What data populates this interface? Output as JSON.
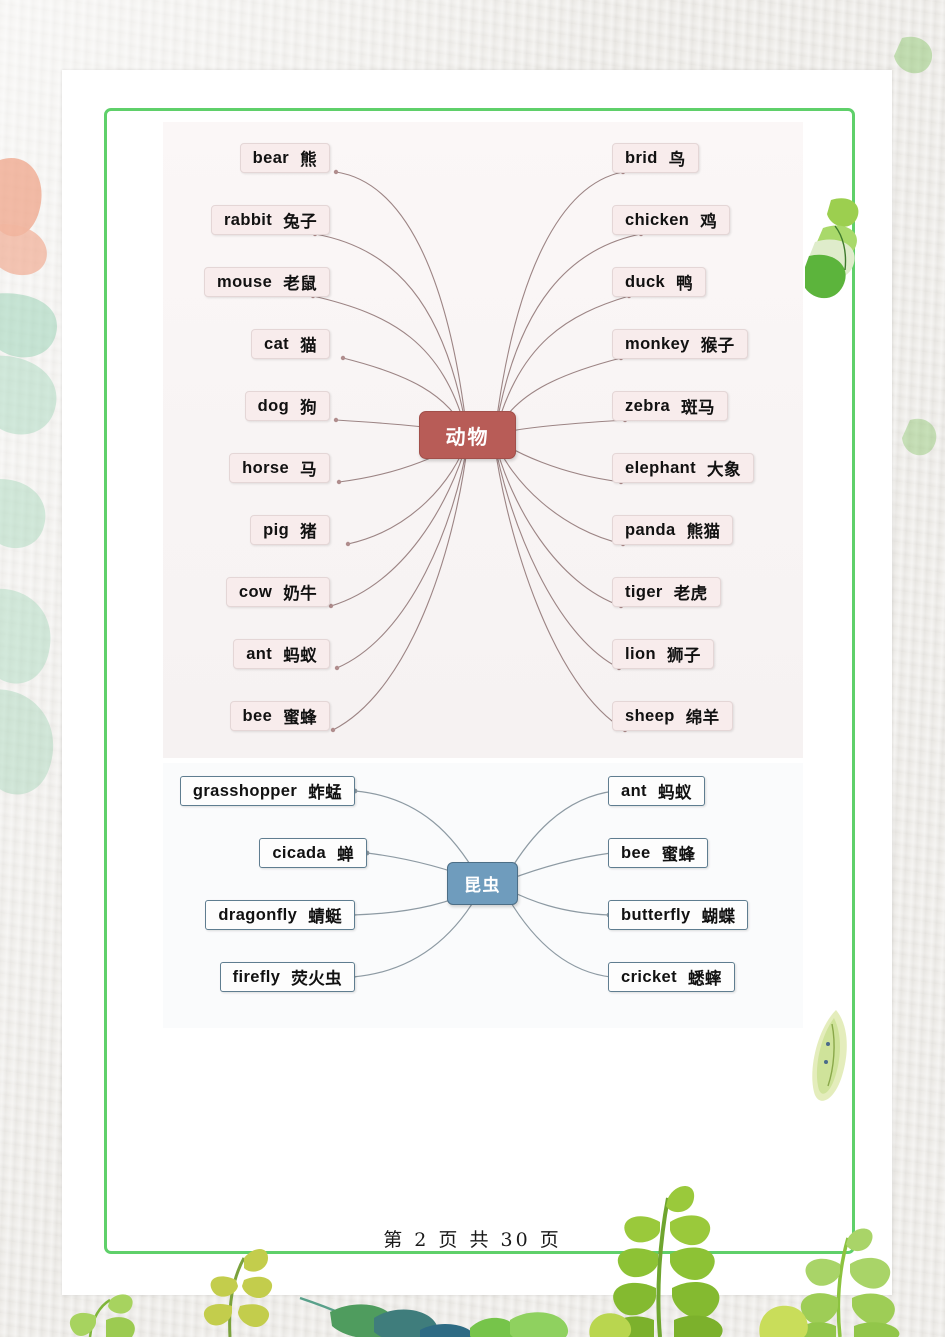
{
  "page": {
    "footer_text": "第 2 页 共 30 页",
    "page_number": "2",
    "total_pages": "30",
    "frame_color": "#5fd06a",
    "background_color": "#eceae6",
    "sheet_color": "#ffffff"
  },
  "animal_map": {
    "center": {
      "label": "动物",
      "color": "#b85c57",
      "text_color": "#ffffff"
    },
    "left_items": [
      {
        "en": "bear",
        "cn": "熊"
      },
      {
        "en": "rabbit",
        "cn": "兔子"
      },
      {
        "en": "mouse",
        "cn": "老鼠"
      },
      {
        "en": "cat",
        "cn": "猫"
      },
      {
        "en": "dog",
        "cn": "狗"
      },
      {
        "en": "horse",
        "cn": "马"
      },
      {
        "en": "pig",
        "cn": "猪"
      },
      {
        "en": "cow",
        "cn": "奶牛"
      },
      {
        "en": "ant",
        "cn": "蚂蚁"
      },
      {
        "en": "bee",
        "cn": "蜜蜂"
      }
    ],
    "right_items": [
      {
        "en": "brid",
        "cn": "鸟"
      },
      {
        "en": "chicken",
        "cn": "鸡"
      },
      {
        "en": "duck",
        "cn": "鸭"
      },
      {
        "en": "monkey",
        "cn": "猴子"
      },
      {
        "en": "zebra",
        "cn": "斑马"
      },
      {
        "en": "elephant",
        "cn": "大象"
      },
      {
        "en": "panda",
        "cn": "熊猫"
      },
      {
        "en": "tiger",
        "cn": "老虎"
      },
      {
        "en": "lion",
        "cn": "狮子"
      },
      {
        "en": "sheep",
        "cn": "绵羊"
      }
    ]
  },
  "insect_map": {
    "center": {
      "label": "昆虫",
      "color": "#6f9cbd",
      "text_color": "#ffffff"
    },
    "left_items": [
      {
        "en": "grasshopper",
        "cn": "蚱蜢"
      },
      {
        "en": "cicada",
        "cn": "蝉"
      },
      {
        "en": "dragonfly",
        "cn": "蜻蜓"
      },
      {
        "en": "firefly",
        "cn": "荧火虫"
      }
    ],
    "right_items": [
      {
        "en": "ant",
        "cn": "蚂蚁"
      },
      {
        "en": "bee",
        "cn": "蜜蜂"
      },
      {
        "en": "butterfly",
        "cn": "蝴蝶"
      },
      {
        "en": "cricket",
        "cn": "蟋蟀"
      }
    ]
  }
}
